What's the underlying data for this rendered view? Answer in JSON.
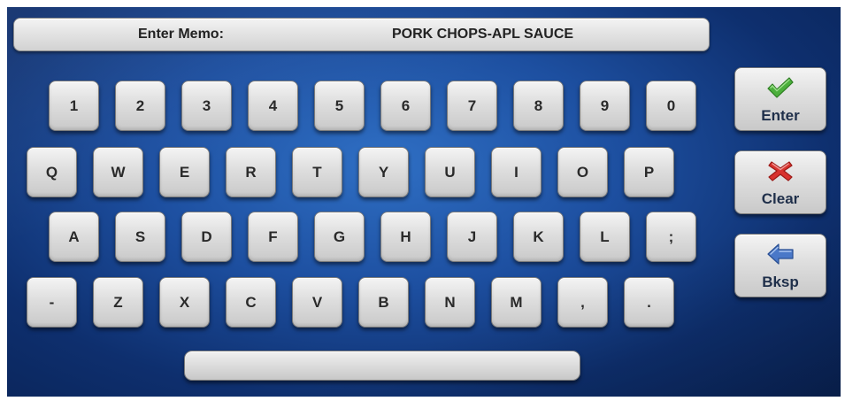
{
  "memo": {
    "label": "Enter Memo:",
    "value": "PORK CHOPS-APL SAUCE"
  },
  "keyboard": {
    "row1": [
      "1",
      "2",
      "3",
      "4",
      "5",
      "6",
      "7",
      "8",
      "9",
      "0"
    ],
    "row2": [
      "Q",
      "W",
      "E",
      "R",
      "T",
      "Y",
      "U",
      "I",
      "O",
      "P"
    ],
    "row3": [
      "A",
      "S",
      "D",
      "F",
      "G",
      "H",
      "J",
      "K",
      "L",
      ";"
    ],
    "row4": [
      "-",
      "Z",
      "X",
      "C",
      "V",
      "B",
      "N",
      "M",
      ",",
      "."
    ],
    "space_label": ""
  },
  "actions": {
    "enter": {
      "label": "Enter",
      "icon": "checkmark-icon",
      "color": "#4caf3c"
    },
    "clear": {
      "label": "Clear",
      "icon": "x-icon",
      "color": "#d8322e"
    },
    "backspace": {
      "label": "Bksp",
      "icon": "left-arrow-icon",
      "color": "#4a78c8"
    }
  },
  "colors": {
    "background": "#1d4fa0",
    "key_face": "#dedede",
    "key_text": "#2a2a2a"
  }
}
